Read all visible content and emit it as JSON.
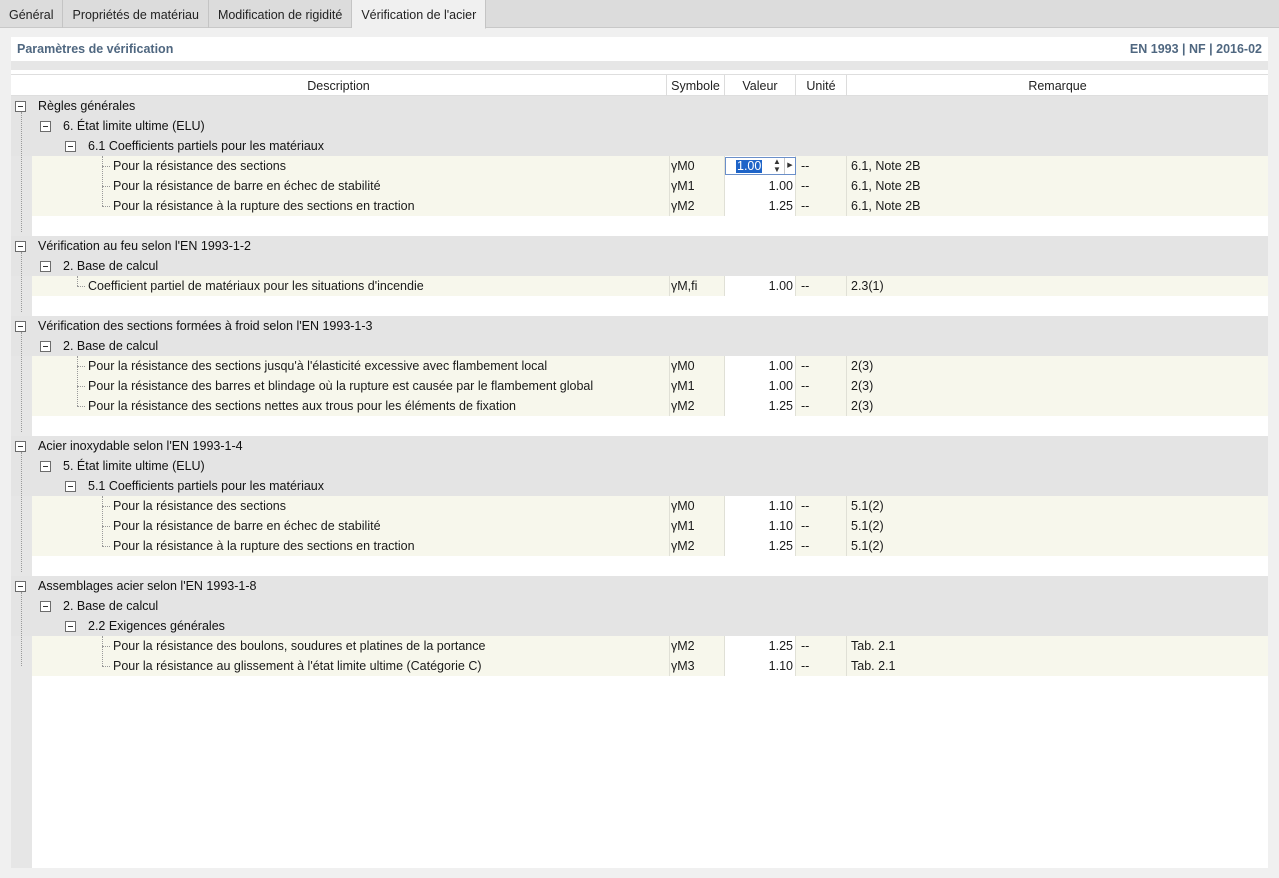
{
  "tabs": [
    {
      "label": "Général",
      "active": false
    },
    {
      "label": "Propriétés de matériau",
      "active": false
    },
    {
      "label": "Modification de rigidité",
      "active": false
    },
    {
      "label": "Vérification de l'acier",
      "active": true
    }
  ],
  "panel": {
    "title": "Paramètres de vérification",
    "standard": "EN 1993 | NF | 2016-02"
  },
  "columns": {
    "description": "Description",
    "symbol": "Symbole",
    "value": "Valeur",
    "unit": "Unité",
    "remark": "Remarque"
  },
  "groups": [
    {
      "label": "Règles générales",
      "sub": "6. État limite ultime (ELU)",
      "subsub": "6.1 Coefficients partiels pour les matériaux",
      "items": [
        {
          "label": "Pour la résistance des sections",
          "symbol": "γM0",
          "value": "1.00",
          "unit": "--",
          "remark": "6.1, Note 2B"
        },
        {
          "label": "Pour la résistance de barre en échec de stabilité",
          "symbol": "γM1",
          "value": "1.00",
          "unit": "--",
          "remark": "6.1, Note 2B"
        },
        {
          "label": "Pour la résistance à la rupture des sections en traction",
          "symbol": "γM2",
          "value": "1.25",
          "unit": "--",
          "remark": "6.1, Note 2B"
        }
      ]
    },
    {
      "label": "Vérification au feu selon l'EN 1993-1-2",
      "sub": "2. Base de calcul",
      "items": [
        {
          "label": "Coefficient partiel de matériaux pour les situations d'incendie",
          "symbol": "γM,fi",
          "value": "1.00",
          "unit": "--",
          "remark": "2.3(1)"
        }
      ]
    },
    {
      "label": "Vérification des sections formées à froid selon l'EN 1993-1-3",
      "sub": "2. Base de calcul",
      "items": [
        {
          "label": "Pour la résistance des sections jusqu'à l'élasticité excessive avec flambement local",
          "symbol": "γM0",
          "value": "1.00",
          "unit": "--",
          "remark": "2(3)"
        },
        {
          "label": "Pour la résistance des barres et blindage où la rupture est causée par le flambement global",
          "symbol": "γM1",
          "value": "1.00",
          "unit": "--",
          "remark": "2(3)"
        },
        {
          "label": "Pour la résistance des sections nettes aux trous pour les éléments de fixation",
          "symbol": "γM2",
          "value": "1.25",
          "unit": "--",
          "remark": "2(3)"
        }
      ]
    },
    {
      "label": "Acier inoxydable selon l'EN 1993-1-4",
      "sub": "5. État limite ultime (ELU)",
      "subsub": "5.1 Coefficients partiels pour les matériaux",
      "items": [
        {
          "label": "Pour la résistance des sections",
          "symbol": "γM0",
          "value": "1.10",
          "unit": "--",
          "remark": "5.1(2)"
        },
        {
          "label": "Pour la résistance de barre en échec de stabilité",
          "symbol": "γM1",
          "value": "1.10",
          "unit": "--",
          "remark": "5.1(2)"
        },
        {
          "label": "Pour la résistance à la rupture des sections en traction",
          "symbol": "γM2",
          "value": "1.25",
          "unit": "--",
          "remark": "5.1(2)"
        }
      ]
    },
    {
      "label": "Assemblages acier selon l'EN 1993-1-8",
      "sub": "2. Base de calcul",
      "subsub": "2.2 Exigences générales",
      "items": [
        {
          "label": "Pour la résistance des boulons, soudures et platines de la portance",
          "symbol": "γM2",
          "value": "1.25",
          "unit": "--",
          "remark": "Tab. 2.1"
        },
        {
          "label": "Pour la résistance au glissement à l'état limite ultime (Catégorie C)",
          "symbol": "γM3",
          "value": "1.10",
          "unit": "--",
          "remark": "Tab. 2.1"
        }
      ]
    }
  ],
  "colors": {
    "header_text": "#4f6780",
    "group_bg": "#e4e4e4",
    "leaf_bg": "#f7f7ec",
    "selection": "#1e64c8"
  }
}
